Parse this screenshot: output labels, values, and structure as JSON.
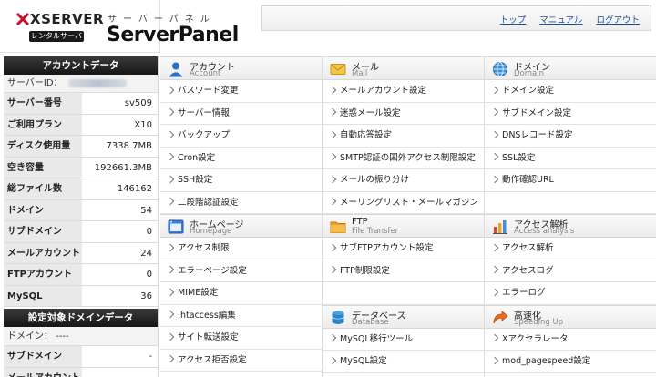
{
  "header": {
    "logo_text": "XSERVER",
    "logo_sub": "レンタルサーバー",
    "brand_kana": "サーバーパネル",
    "brand_name": "ServerPanel",
    "links": [
      "トップ",
      "マニュアル",
      "ログアウト"
    ]
  },
  "sidebar": {
    "account_title": "アカウントデータ",
    "server_id_label": "サーバーID：",
    "rows": [
      {
        "label": "サーバー番号",
        "value": "sv509"
      },
      {
        "label": "ご利用プラン",
        "value": "X10"
      },
      {
        "label": "ディスク使用量",
        "value": "7338.7MB"
      },
      {
        "label": "空き容量",
        "value": "192661.3MB"
      },
      {
        "label": "総ファイル数",
        "value": "146162"
      },
      {
        "label": "ドメイン",
        "value": "54"
      },
      {
        "label": "サブドメイン",
        "value": "0"
      },
      {
        "label": "メールアカウント",
        "value": "24"
      },
      {
        "label": "FTPアカウント",
        "value": "0"
      },
      {
        "label": "MySQL",
        "value": "36"
      }
    ],
    "domain_title": "設定対象ドメインデータ",
    "domain_line": "ドメイン： ----",
    "domain_rows": [
      {
        "label": "サブドメイン",
        "value": "-"
      },
      {
        "label": "メールアカウント",
        "value": "-"
      }
    ]
  },
  "sections": {
    "account": {
      "title": "アカウント",
      "sub": "Account",
      "items": [
        "パスワード変更",
        "サーバー情報",
        "バックアップ",
        "Cron設定",
        "SSH設定",
        "二段階認証設定"
      ]
    },
    "mail": {
      "title": "メール",
      "sub": "Mail",
      "items": [
        "メールアカウント設定",
        "迷惑メール設定",
        "自動応答設定",
        "SMTP認証の国外アクセス制限設定",
        "メールの振り分け",
        "メーリングリスト・メールマガジン"
      ]
    },
    "domain": {
      "title": "ドメイン",
      "sub": "Domain",
      "items": [
        "ドメイン設定",
        "サブドメイン設定",
        "DNSレコード設定",
        "SSL設定",
        "動作確認URL",
        ""
      ]
    },
    "homepage": {
      "title": "ホームページ",
      "sub": "Homepage",
      "items": [
        "アクセス制限",
        "エラーページ設定",
        "MIME設定",
        ".htaccess編集",
        "サイト転送設定",
        "アクセス拒否設定"
      ]
    },
    "ftp": {
      "title": "FTP",
      "sub": "File Transfer",
      "items": [
        "サブFTPアカウント設定",
        "FTP制限設定",
        ""
      ]
    },
    "database": {
      "title": "データベース",
      "sub": "Database",
      "items": [
        "MySQL移行ツール",
        "MySQL設定"
      ]
    },
    "access": {
      "title": "アクセス解析",
      "sub": "Access analysis",
      "items": [
        "アクセス解析",
        "アクセスログ",
        "エラーログ"
      ]
    },
    "speed": {
      "title": "高速化",
      "sub": "Speeding Up",
      "items": [
        "Xアクセラレータ",
        "mod_pagespeed設定"
      ]
    }
  }
}
